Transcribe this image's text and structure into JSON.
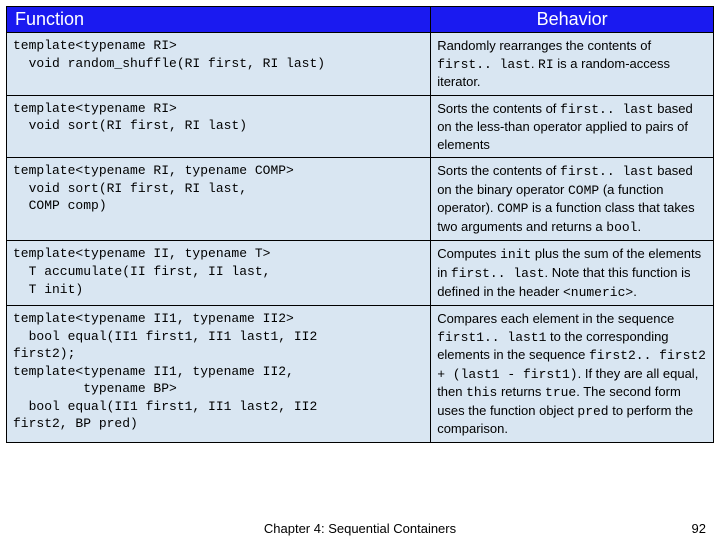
{
  "headers": {
    "function": "Function",
    "behavior": "Behavior"
  },
  "rows": [
    {
      "func": "template<typename RI>\n  void random_shuffle(RI first, RI last)",
      "beh_html": "Randomly rearranges the contents of <span class=\"mono\">first.. last</span>. <span class=\"mono\">RI</span> is a random-access iterator."
    },
    {
      "func": "template<typename RI>\n  void sort(RI first, RI last)",
      "beh_html": "Sorts the contents of <span class=\"mono\">first.. last</span> based on the less-than operator applied to pairs of elements"
    },
    {
      "func": "template<typename RI, typename COMP>\n  void sort(RI first, RI last,\n  COMP comp)",
      "beh_html": "Sorts the contents of <span class=\"mono\">first.. last</span> based on the binary operator <span class=\"mono\">COMP</span> (a function operator). <span class=\"mono\">COMP</span> is a function class that takes two arguments and returns a <span class=\"mono\">bool</span>."
    },
    {
      "func": "template<typename II, typename T>\n  T accumulate(II first, II last,\n  T init)",
      "beh_html": "Computes <span class=\"mono\">init</span> plus the sum of the elements in <span class=\"mono\">first.. last</span>. Note that this function is defined in the header <span class=\"mono\">&lt;numeric&gt;</span>."
    },
    {
      "func": "template<typename II1, typename II2>\n  bool equal(II1 first1, II1 last1, II2\nfirst2);\ntemplate<typename II1, typename II2,\n         typename BP>\n  bool equal(II1 first1, II1 last2, II2\nfirst2, BP pred)",
      "beh_html": "Compares each element in the sequence <span class=\"mono\">first1.. last1</span> to the corresponding elements in the sequence <span class=\"mono\">first2.. first2 + (last1 - first1)</span>. If they are all equal, then <span class=\"mono\">this</span> returns <span class=\"mono\">true</span>. The second form uses the function object <span class=\"mono\">pred</span> to perform the comparison."
    }
  ],
  "footer": {
    "title": "Chapter 4: Sequential Containers",
    "page": "92"
  }
}
